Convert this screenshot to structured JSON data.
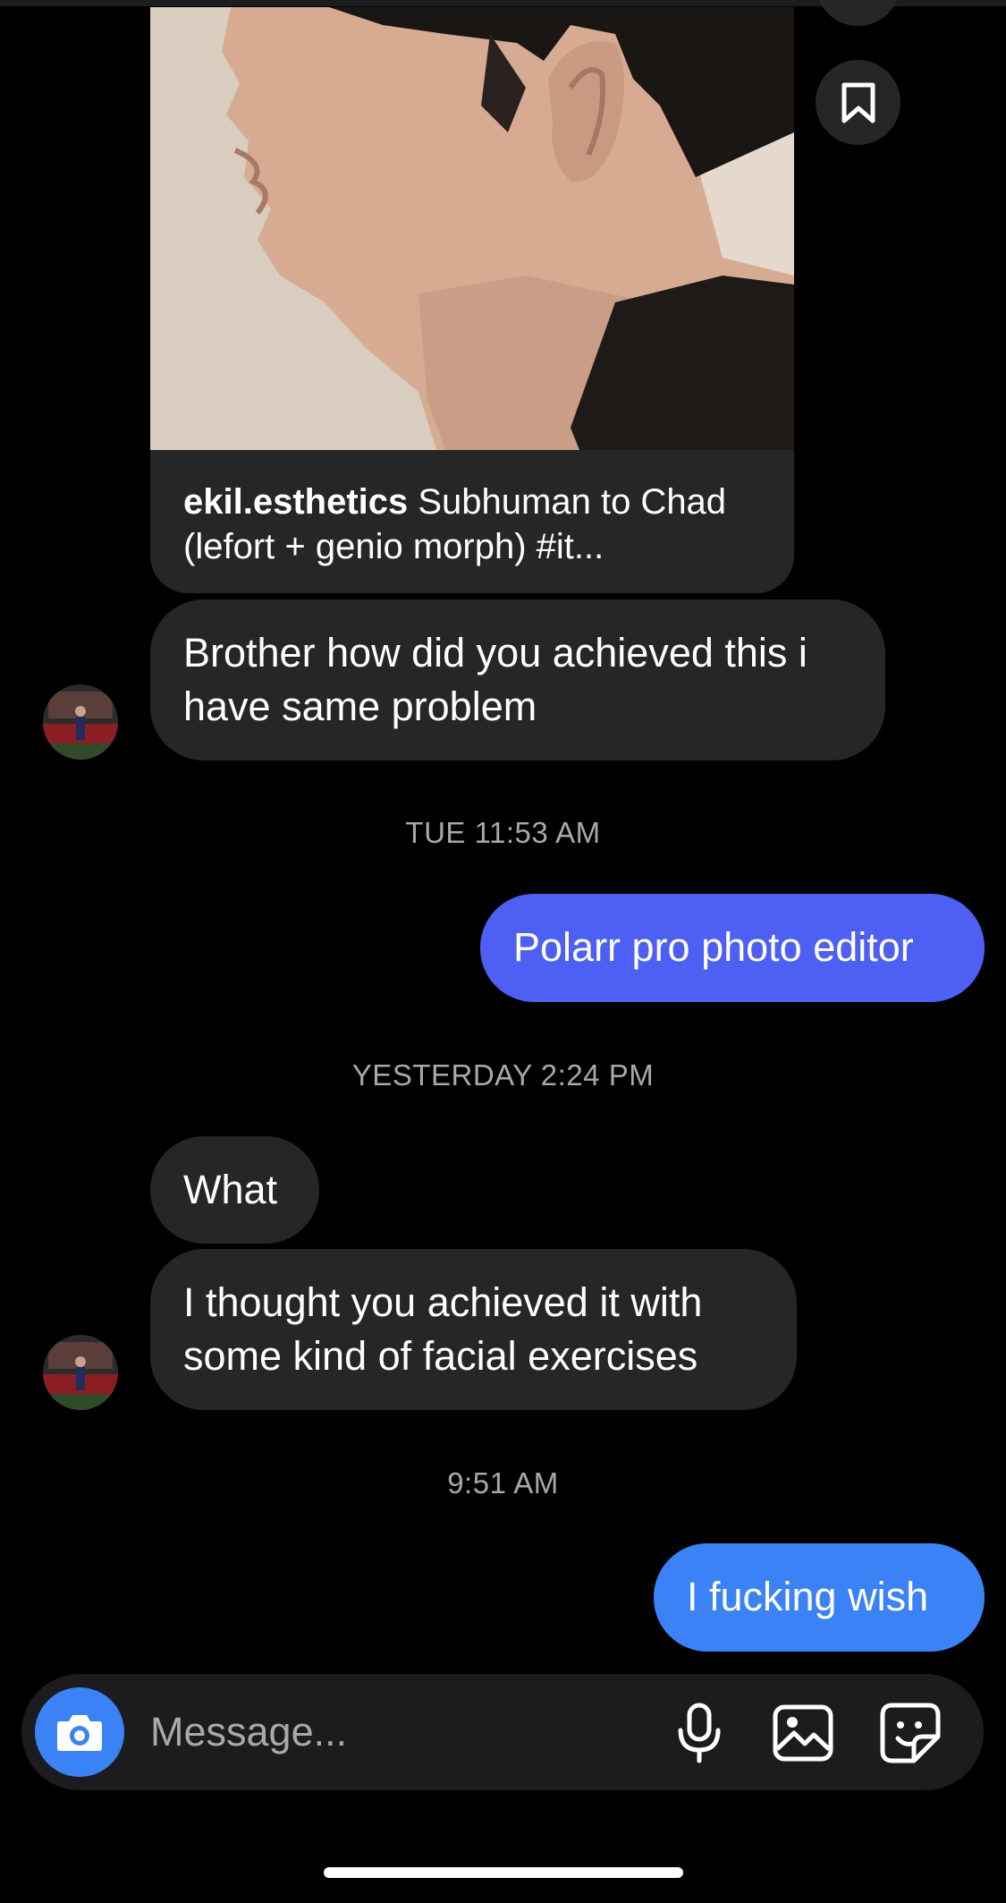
{
  "shared_post": {
    "username": "ekil.esthetics",
    "caption": " Subhuman to Chad (lefort + genio morph) #it..."
  },
  "thread": {
    "incoming_1": "Brother how did you achieved this i have same problem",
    "timestamp_1": "TUE 11:53 AM",
    "outgoing_1": "Polarr pro photo editor",
    "timestamp_2": "YESTERDAY 2:24 PM",
    "incoming_2": "What",
    "incoming_3": "I thought you achieved it with some kind of facial exercises",
    "timestamp_3": "9:51 AM",
    "outgoing_2": "I fucking wish"
  },
  "composer": {
    "placeholder": "Message..."
  },
  "icons": {
    "save": "bookmark-icon",
    "camera": "camera-icon",
    "mic": "microphone-icon",
    "gallery": "image-icon",
    "sticker": "sticker-icon"
  },
  "colors": {
    "background": "#000000",
    "incoming_bubble": "#262626",
    "outgoing_bubble_older": "#4e5ff3",
    "outgoing_bubble_latest": "#3b82f6",
    "timestamp": "#a8a8a8"
  }
}
